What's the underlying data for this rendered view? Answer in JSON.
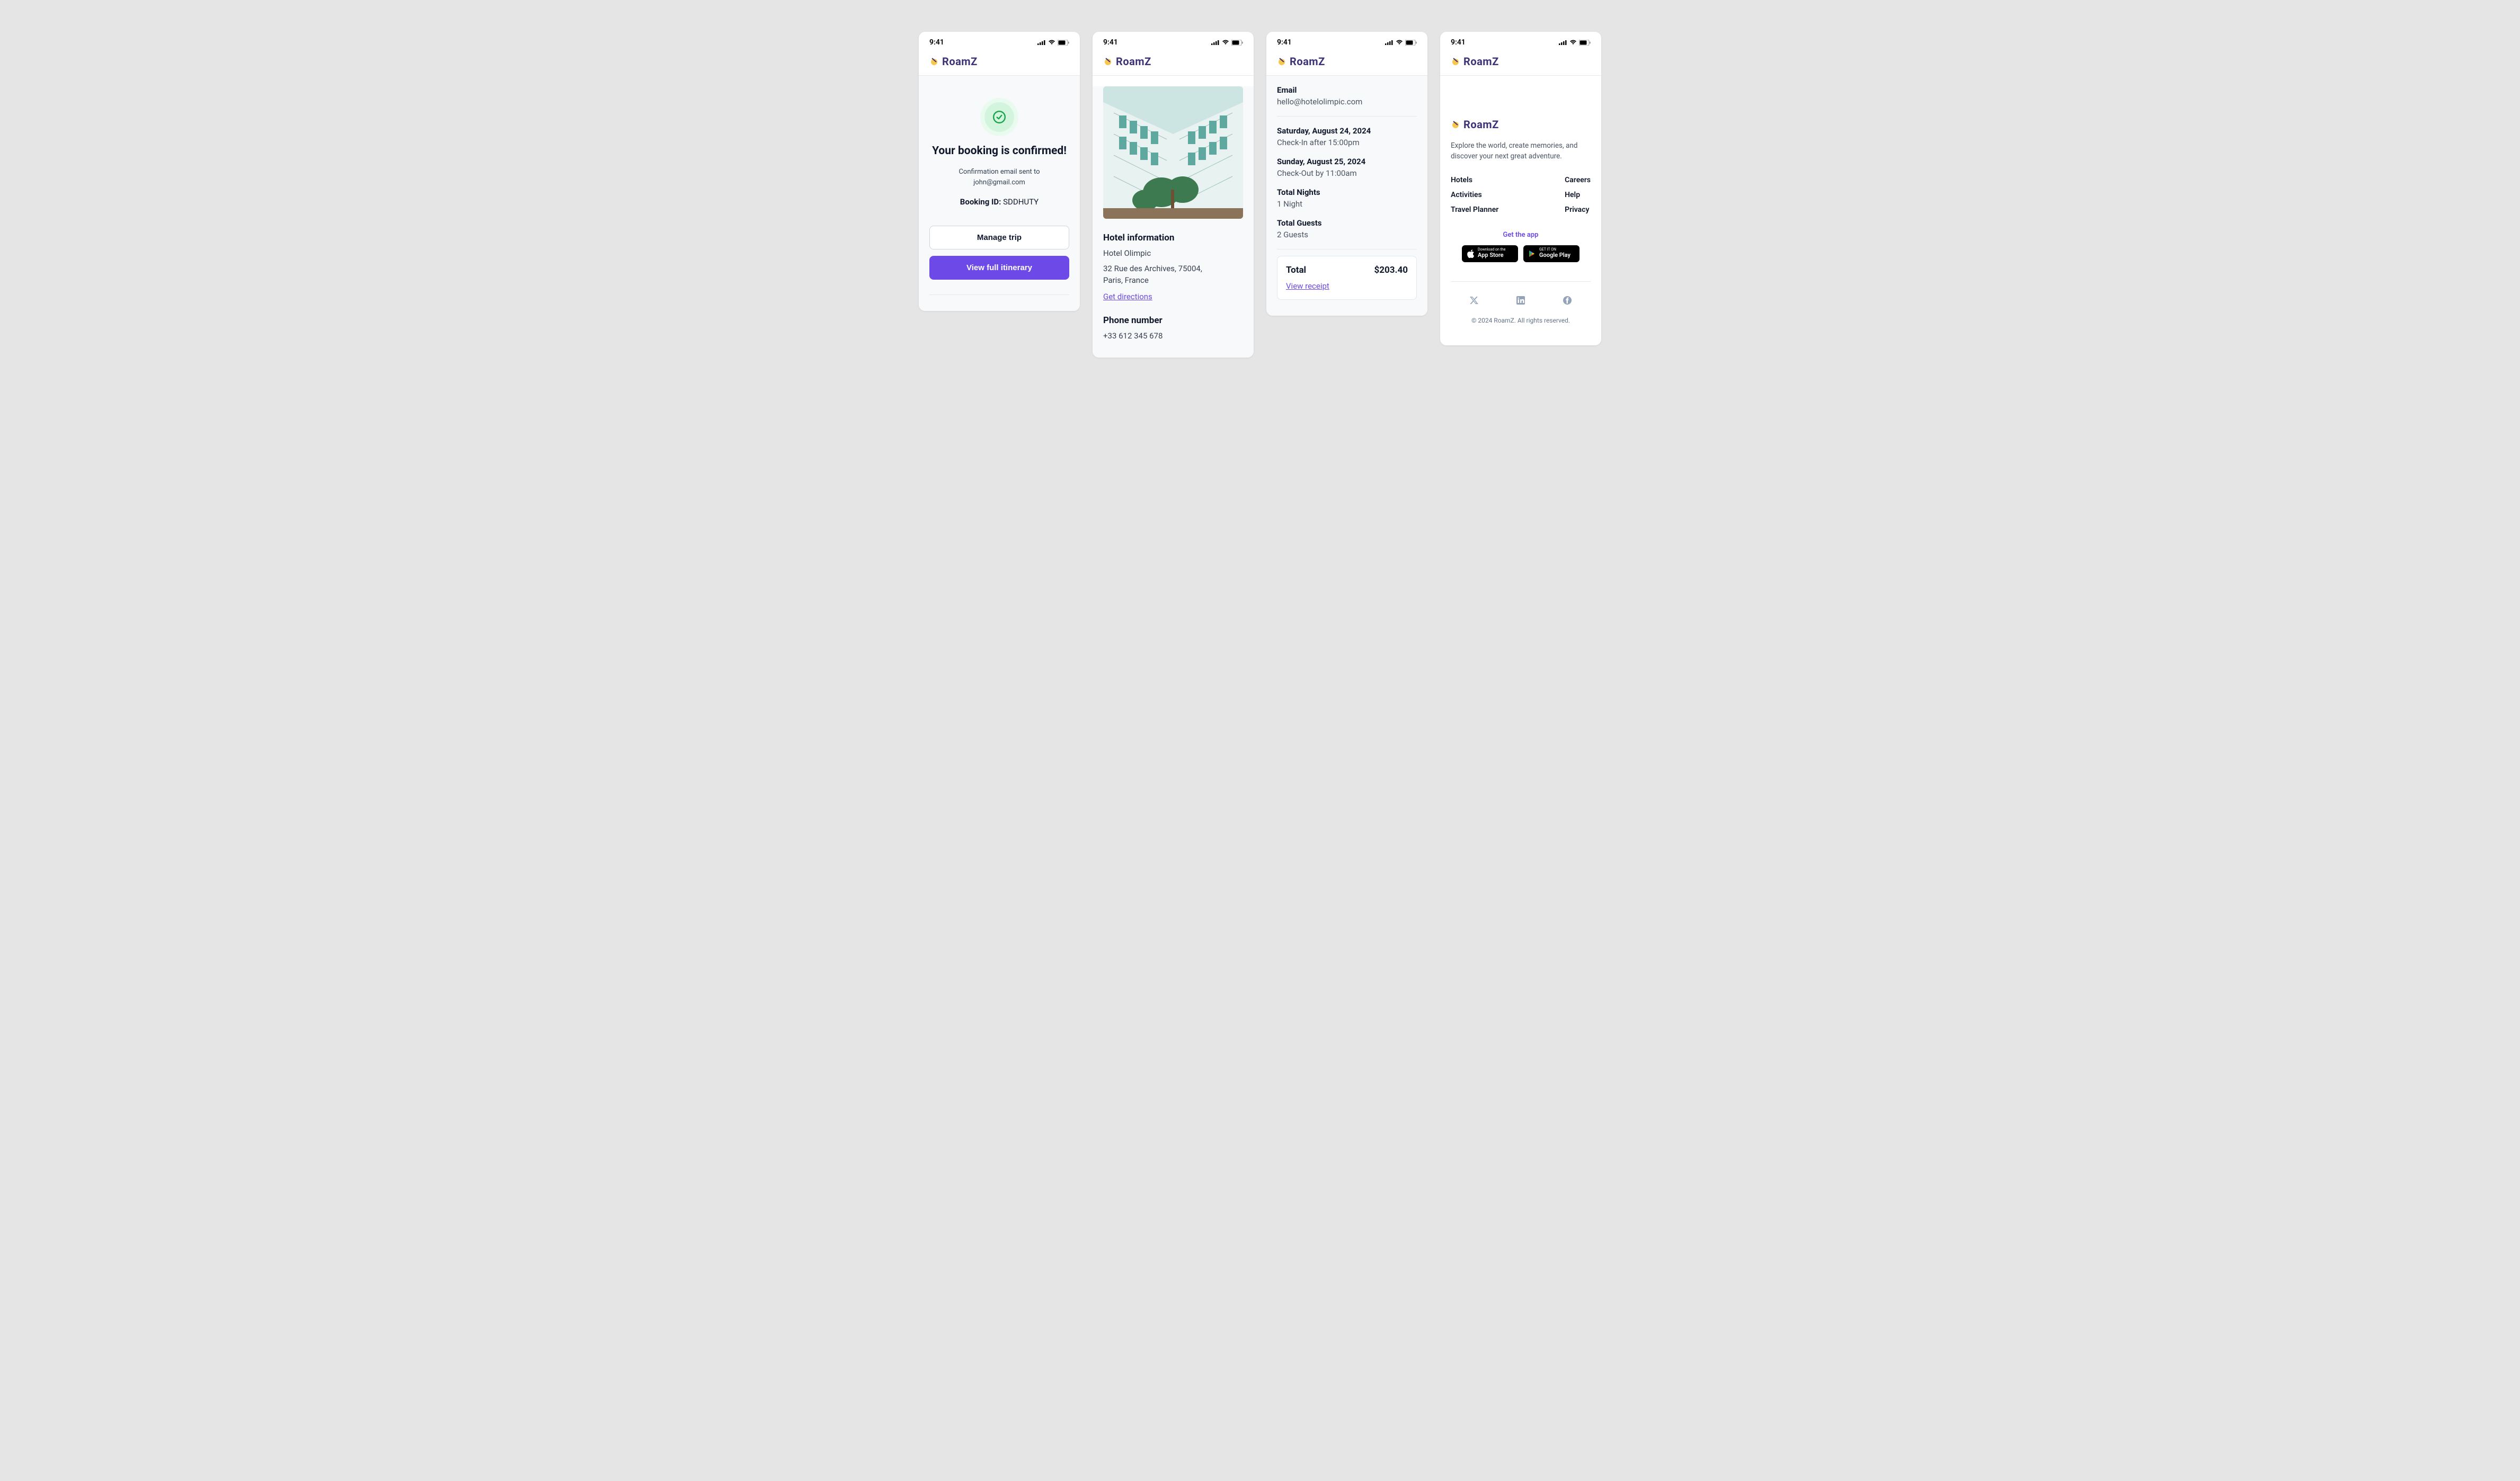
{
  "status_time": "9:41",
  "brand": "RoamZ",
  "screen1": {
    "title": "Your booking is confirmed!",
    "sent_line1": "Confirmation email sent to",
    "sent_line2": "john@gmail.com",
    "booking_id_label": "Booking ID:",
    "booking_id_value": "SDDHUTY",
    "manage_btn": "Manage trip",
    "itinerary_btn": "View full itinerary"
  },
  "screen2": {
    "hotel_info_title": "Hotel information",
    "hotel_name": "Hotel Olimpic",
    "address_line1": "32 Rue des Archives, 75004,",
    "address_line2": "Paris, France",
    "directions": "Get directions",
    "phone_title": "Phone number",
    "phone_value": "+33 612 345 678"
  },
  "screen3": {
    "email_label": "Email",
    "email_value": "hello@hotelolimpic.com",
    "checkin_date": "Saturday, August 24, 2024",
    "checkin_time": "Check-In after 15:00pm",
    "checkout_date": "Sunday, August 25, 2024",
    "checkout_time": "Check-Out by 11:00am",
    "nights_label": "Total Nights",
    "nights_value": "1 Night",
    "guests_label": "Total Guests",
    "guests_value": "2 Guests",
    "total_label": "Total",
    "total_value": "$203.40",
    "receipt": "View receipt"
  },
  "screen4": {
    "footer_desc": "Explore the world, create memories, and discover your next great adventure.",
    "links_col1": [
      "Hotels",
      "Activities",
      "Travel Planner"
    ],
    "links_col2": [
      "Careers",
      "Help",
      "Privacy"
    ],
    "get_app": "Get the app",
    "appstore_small": "Download on the",
    "appstore_big": "App Store",
    "play_small": "GET IT ON",
    "play_big": "Google Play",
    "copyright": "© 2024 RoamZ. All rights reserved."
  }
}
